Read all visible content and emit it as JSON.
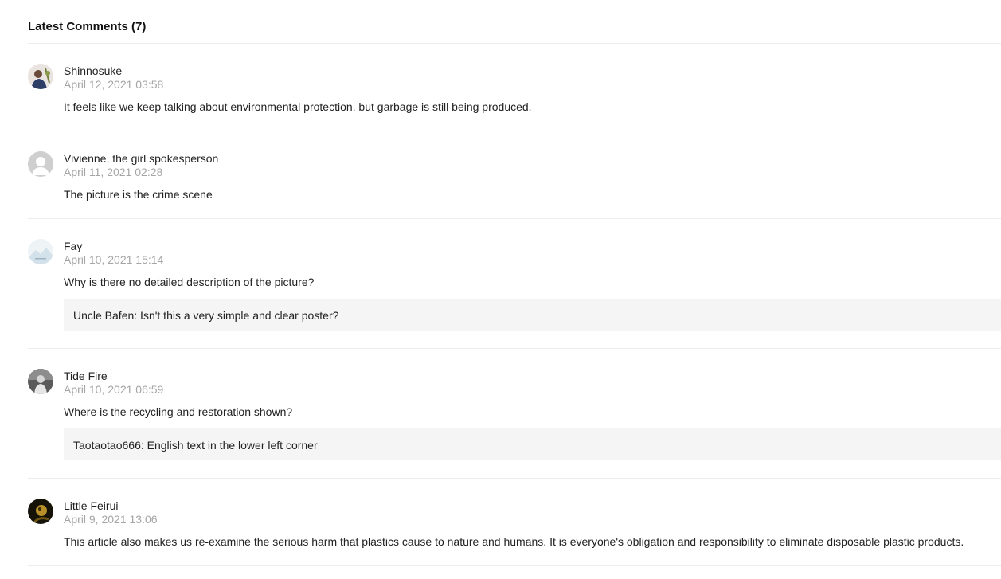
{
  "section": {
    "title": "Latest Comments (7)"
  },
  "comments": [
    {
      "username": "Shinnosuke",
      "timestamp": "April 12, 2021 03:58",
      "text": "It feels like we keep talking about environmental protection, but garbage is still being produced."
    },
    {
      "username": "Vivienne, the girl spokesperson",
      "timestamp": "April 11, 2021 02:28",
      "text": "The picture is the crime scene"
    },
    {
      "username": "Fay",
      "timestamp": "April 10, 2021 15:14",
      "text": "Why is there no detailed description of the picture?",
      "reply": "Uncle Bafen: Isn't this a very simple and clear poster?"
    },
    {
      "username": "Tide Fire",
      "timestamp": "April 10, 2021 06:59",
      "text": "Where is the recycling and restoration shown?",
      "reply": "Taotaotao666: English text in the lower left corner"
    },
    {
      "username": "Little Feirui",
      "timestamp": "April 9, 2021 13:06",
      "text": "This article also makes us re-examine the serious harm that plastics cause to nature and humans. It is everyone's obligation and responsibility to eliminate disposable plastic products."
    }
  ],
  "icons": {
    "avatar_1": "user-photo-avatar",
    "avatar_2": "default-user-avatar",
    "avatar_3": "landscape-avatar",
    "avatar_4": "user-photo-avatar",
    "avatar_5": "user-photo-avatar"
  }
}
